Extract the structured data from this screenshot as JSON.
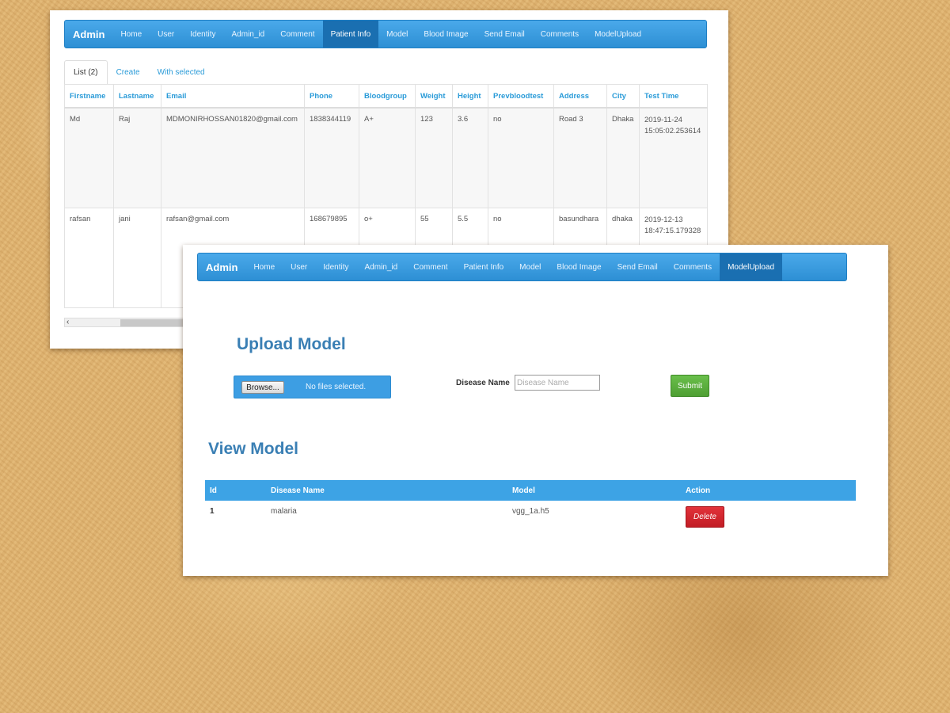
{
  "back_window": {
    "navbar": {
      "brand": "Admin",
      "items": [
        "Home",
        "User",
        "Identity",
        "Admin_id",
        "Comment",
        "Patient Info",
        "Model",
        "Blood Image",
        "Send Email",
        "Comments",
        "ModelUpload"
      ],
      "active": "Patient Info"
    },
    "tabs": [
      "List (2)",
      "Create",
      "With selected"
    ],
    "table": {
      "headers": [
        "Firstname",
        "Lastname",
        "Email",
        "Phone",
        "Bloodgroup",
        "Weight",
        "Height",
        "Prevbloodtest",
        "Address",
        "City",
        "Test Time"
      ],
      "rows": [
        [
          "Md",
          "Raj",
          "MDMONIRHOSSAN01820@gmail.com",
          "1838344119",
          "A+",
          "123",
          "3.6",
          "no",
          "Road 3",
          "Dhaka",
          "2019-11-24 15:05:02.253614"
        ],
        [
          "rafsan",
          "jani",
          "rafsan@gmail.com",
          "168679895",
          "o+",
          "55",
          "5.5",
          "no",
          "basundhara",
          "dhaka",
          "2019-12-13 18:47:15.179328"
        ]
      ]
    },
    "scroll_arrow": "‹"
  },
  "front_window": {
    "navbar": {
      "brand": "Admin",
      "items": [
        "Home",
        "User",
        "Identity",
        "Admin_id",
        "Comment",
        "Patient Info",
        "Model",
        "Blood Image",
        "Send Email",
        "Comments",
        "ModelUpload"
      ],
      "active": "ModelUpload"
    },
    "upload": {
      "title": "Upload Model",
      "browse_label": "Browse...",
      "no_file_text": "No files selected.",
      "disease_label": "Disease Name",
      "disease_placeholder": "Disease Name",
      "disease_value": "",
      "submit_label": "Submit"
    },
    "view": {
      "title": "View Model",
      "headers": [
        "Id",
        "Disease Name",
        "Model",
        "Action"
      ],
      "rows": [
        {
          "id": "1",
          "disease": "malaria",
          "model": "vgg_1a.h5",
          "action": "Delete"
        }
      ]
    }
  },
  "colors": {
    "navbar": "#2d8fd4",
    "nav_active": "#1a6fb1",
    "heading": "#3a7fb4",
    "table_header": "#3da3e5",
    "submit": "#4e9f33",
    "delete": "#c21d25",
    "background": "#e0b36f"
  }
}
